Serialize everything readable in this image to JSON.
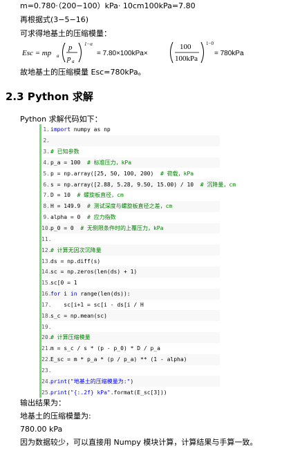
{
  "top": {
    "line1": "m=0.780·（200−100）kPa· 10cm100kPa=7.80",
    "line2": "再根据式(3−5−16)",
    "line3": "可求得地基土的压缩模量：",
    "line4": "故地基土的压缩模量 Esc=780kPa。"
  },
  "formula": {
    "lhs": "Esc = mp",
    "lhs_sub": "a",
    "frac1_num": "p",
    "frac1_den": "p",
    "frac1_den_sub": "a",
    "exp1": "1−α",
    "eq1": "= 7.80×100kPa×",
    "frac2_num": "100",
    "frac2_den": "100kPa",
    "exp2": "1−0",
    "eq2": "= 780kPa"
  },
  "section": {
    "heading": "2.3 Python 求解",
    "intro": "Python 求解代码如下："
  },
  "code_lines": [
    {
      "n": "1",
      "parts": [
        [
          "kw",
          "import"
        ],
        [
          "tx",
          " numpy as np"
        ]
      ]
    },
    {
      "n": "2",
      "parts": []
    },
    {
      "n": "3",
      "parts": [
        [
          "cm",
          "# 已知参数"
        ]
      ]
    },
    {
      "n": "4",
      "parts": [
        [
          "tx",
          "p_a = 100  "
        ],
        [
          "cm",
          "# 标准压力，kPa"
        ]
      ]
    },
    {
      "n": "5",
      "parts": [
        [
          "tx",
          "p = np.array([25, 50, 100, 200)  "
        ],
        [
          "cm",
          "# 荷载，kPa"
        ]
      ]
    },
    {
      "n": "6",
      "parts": [
        [
          "tx",
          "s = np.array([2.88, 5.28, 9.50, 15.00) / 10  "
        ],
        [
          "cm",
          "# 沉降量，cm"
        ]
      ]
    },
    {
      "n": "7",
      "parts": [
        [
          "tx",
          "D = 10  "
        ],
        [
          "cm",
          "# 螺旋板直径，cm"
        ]
      ]
    },
    {
      "n": "8",
      "parts": [
        [
          "tx",
          "H = 149.9  "
        ],
        [
          "cm",
          "# 测试深度与螺旋板直径之差，cm"
        ]
      ]
    },
    {
      "n": "9",
      "parts": [
        [
          "tx",
          "alpha = 0  "
        ],
        [
          "cm",
          "# 应力指数"
        ]
      ]
    },
    {
      "n": "10",
      "parts": [
        [
          "tx",
          "p_0 = 0  "
        ],
        [
          "cm",
          "# 无侧限条件时的上覆压力，kPa"
        ]
      ]
    },
    {
      "n": "11",
      "parts": []
    },
    {
      "n": "12",
      "parts": [
        [
          "cm",
          "# 计算无因次沉降量"
        ]
      ]
    },
    {
      "n": "13",
      "parts": [
        [
          "tx",
          "ds = np.diff(s)"
        ]
      ]
    },
    {
      "n": "14",
      "parts": [
        [
          "tx",
          "sc = np.zeros(len(ds) + 1)"
        ]
      ]
    },
    {
      "n": "15",
      "parts": [
        [
          "tx",
          "sc[0 = 1"
        ]
      ]
    },
    {
      "n": "16",
      "parts": [
        [
          "kw",
          "for"
        ],
        [
          "tx",
          " i "
        ],
        [
          "kw",
          "in"
        ],
        [
          "tx",
          " range(len(ds)):"
        ]
      ]
    },
    {
      "n": "17",
      "parts": [
        [
          "tx",
          "    sc[i+1 = sc[i - ds[i / H"
        ]
      ]
    },
    {
      "n": "18",
      "parts": [
        [
          "tx",
          "s_c = np.mean(sc)"
        ]
      ]
    },
    {
      "n": "19",
      "parts": []
    },
    {
      "n": "20",
      "parts": [
        [
          "cm",
          "# 计算压缩模量"
        ]
      ]
    },
    {
      "n": "21",
      "parts": [
        [
          "tx",
          "m = s_c / s * (p - p_0) * D / p_a"
        ]
      ]
    },
    {
      "n": "22",
      "parts": [
        [
          "tx",
          "E_sc = m * p_a * (p / p_a) ** (1 - alpha)"
        ]
      ]
    },
    {
      "n": "23",
      "parts": []
    },
    {
      "n": "24",
      "parts": [
        [
          "kw",
          "print"
        ],
        [
          "tx",
          "("
        ],
        [
          "st",
          "\"地基土的压缩模量为:\""
        ],
        [
          "tx",
          ")"
        ]
      ]
    },
    {
      "n": "25",
      "parts": [
        [
          "kw",
          "print"
        ],
        [
          "tx",
          "("
        ],
        [
          "st",
          "\"{:.2f} kPa\""
        ],
        [
          "tx",
          ".format(E_sc[3]))"
        ]
      ]
    }
  ],
  "output": {
    "label": "输出结果为：",
    "result_label": "地基土的压缩模量为:",
    "result_value": "780.00 kPa",
    "conclusion": "因为数据较少，可以直接用  Numpy  模块计算，计算结果与手算一致。"
  }
}
